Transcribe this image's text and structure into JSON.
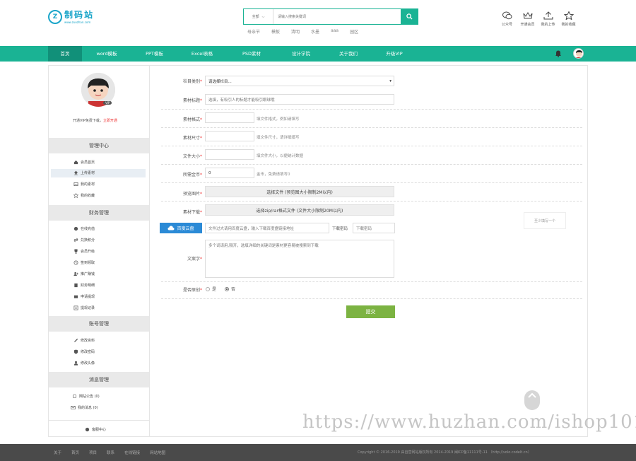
{
  "logo": {
    "badge": "Z",
    "name": "制码站",
    "url": "www.zuozhan.com"
  },
  "search": {
    "category": "全部",
    "placeholder": "请输入搜索关键词",
    "hot": [
      "母亲节",
      "模板",
      "清明",
      "水墨",
      "aaa",
      "园区"
    ]
  },
  "top_icons": [
    {
      "icon": "wechat-icon",
      "label": "公众号"
    },
    {
      "icon": "crown-icon",
      "label": "开通会员"
    },
    {
      "icon": "upload-icon",
      "label": "我的上传"
    },
    {
      "icon": "star-icon",
      "label": "我的收藏"
    }
  ],
  "nav": {
    "items": [
      "首页",
      "word模板",
      "PPT模板",
      "Excel表格",
      "PSD素材",
      "设计学院",
      "关于我们",
      "升级VIP"
    ],
    "accent": "#1ab394",
    "active_bg": "#119079"
  },
  "sidebar": {
    "vip": "VIP",
    "vip_text": "开通VIP免费下载，",
    "vip_link": "立即开通",
    "sections": [
      {
        "title": "管理中心",
        "items": [
          {
            "icon": "home-icon",
            "label": "会员首页"
          },
          {
            "icon": "upload-icon",
            "label": "上传素材"
          },
          {
            "icon": "image-icon",
            "label": "我的素材"
          },
          {
            "icon": "star-icon",
            "label": "我的收藏"
          }
        ]
      },
      {
        "title": "财务管理",
        "items": [
          {
            "icon": "coin-icon",
            "label": "在线充值"
          },
          {
            "icon": "exchange-icon",
            "label": "兑换积分"
          },
          {
            "icon": "trophy-icon",
            "label": "会员升级"
          },
          {
            "icon": "clock-icon",
            "label": "签到领取"
          },
          {
            "icon": "user-plus-icon",
            "label": "推广赚钱"
          },
          {
            "icon": "doc-icon",
            "label": "财务明细"
          },
          {
            "icon": "wallet-icon",
            "label": "申请提现"
          },
          {
            "icon": "list-icon",
            "label": "提现记录"
          }
        ]
      },
      {
        "title": "账号管理",
        "items": [
          {
            "icon": "pen-icon",
            "label": "修改资料"
          },
          {
            "icon": "shield-icon",
            "label": "修改密码"
          },
          {
            "icon": "person-icon",
            "label": "修改头像"
          }
        ]
      },
      {
        "title": "消息管理",
        "items": [
          {
            "icon": "bell-icon",
            "label": "网站公告 (0)"
          },
          {
            "icon": "mail-icon",
            "label": "我的消息 (0)"
          }
        ]
      }
    ],
    "footer": "客服中心"
  },
  "form": {
    "category": {
      "label": "栏目类别",
      "value": "请选择栏目..."
    },
    "title": {
      "label": "素材标题",
      "placeholder": "选填，有吸引人的标题才能吸引眼球哦"
    },
    "format": {
      "label": "素材格式",
      "hint": "填文件格式，例如请填写"
    },
    "size": {
      "label": "素材尺寸",
      "hint": "填文件尺寸，请详细填写"
    },
    "filesize": {
      "label": "文件大小",
      "hint": "填文件大小，以便统计数据"
    },
    "coins": {
      "label": "所需金币",
      "value": "0",
      "hint": "金币，免费请填写0"
    },
    "preview": {
      "label": "预览图片",
      "button": "选择文件 (预览图大小限制2M以内)"
    },
    "download": {
      "label": "素材下载",
      "button": "选择zip/rar格式文件 (文件大小限制20M以内)"
    },
    "baidu": {
      "button": "百度云盘",
      "placeholder": "文件过大请用百度云盘，输入下载百度盘链接地址",
      "code_label": "下载密码",
      "code_placeholder": "下载密码"
    },
    "desc": {
      "label": "文案字",
      "placeholder": "多个词请用,隔开，选填详细的关键词是素材更容易被搜索到下载"
    },
    "original": {
      "label": "是否原创",
      "yes": "是",
      "no": "否"
    },
    "submit": "提交",
    "side_hint": "至少填写一个"
  },
  "footer": {
    "links": [
      "关于",
      "首页",
      "项目",
      "联系",
      "在线链接",
      "网站地图"
    ],
    "copyright": "Copyright © 2016-2019 由自营网站版权所有 2014-2019 闽ICP备11111号-11  （http://volo.codelt.cn）"
  },
  "watermark": "https://www.huzhan.com/ishop1012"
}
